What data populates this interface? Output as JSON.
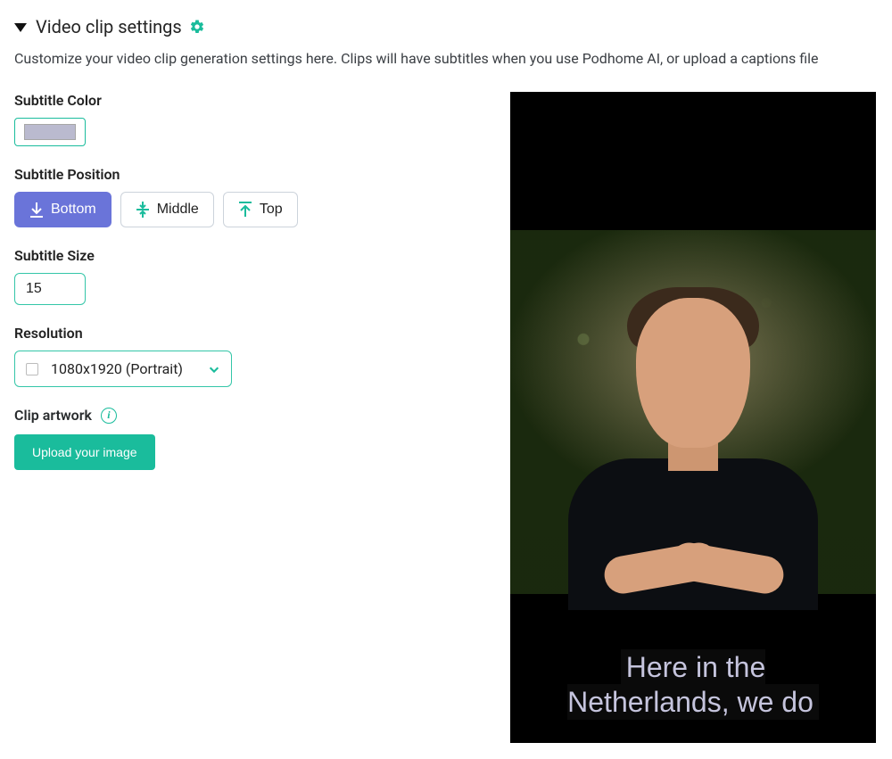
{
  "header": {
    "title": "Video clip settings"
  },
  "description": "Customize your video clip generation settings here. Clips will have subtitles when you use Podhome AI, or upload a captions file",
  "form": {
    "subtitleColor": {
      "label": "Subtitle Color",
      "value": "#babacf"
    },
    "subtitlePosition": {
      "label": "Subtitle Position",
      "options": {
        "bottom": "Bottom",
        "middle": "Middle",
        "top": "Top"
      },
      "selected": "bottom"
    },
    "subtitleSize": {
      "label": "Subtitle Size",
      "value": "15"
    },
    "resolution": {
      "label": "Resolution",
      "selected": "1080x1920 (Portrait)"
    },
    "clipArtwork": {
      "label": "Clip artwork",
      "uploadLabel": "Upload your image"
    }
  },
  "preview": {
    "subtitleText": "Here in the\nNetherlands, we do"
  }
}
